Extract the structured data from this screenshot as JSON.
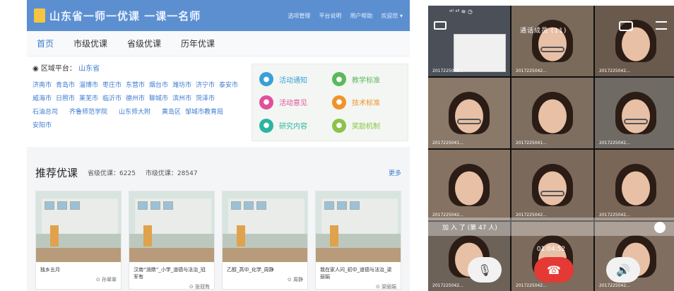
{
  "left": {
    "logo_text": "山东省一师一优课 一课一名师",
    "top_links": [
      "选项管理",
      "平台说明",
      "用户帮助",
      "欢迎您 ▾"
    ],
    "nav": [
      {
        "label": "首页",
        "active": true
      },
      {
        "label": "市级优课",
        "active": false
      },
      {
        "label": "省级优课",
        "active": false
      },
      {
        "label": "历年优课",
        "active": false
      }
    ],
    "region": {
      "title": "区域平台：",
      "province": "山东省"
    },
    "cities": [
      "济南市",
      "青岛市",
      "淄博市",
      "枣庄市",
      "东营市",
      "烟台市",
      "潍坊市",
      "济宁市",
      "泰安市",
      "威海市",
      "日照市",
      "莱芜市",
      "临沂市",
      "德州市",
      "聊城市",
      "滨州市",
      "菏泽市",
      "石油总司",
      "齐鲁师范学院",
      "山东师大附",
      "黄岛区",
      "邹城市教育局",
      "安阳市"
    ],
    "features": [
      {
        "label": "活动通知",
        "icon": "megaphone-icon",
        "color": "#3aa0d8"
      },
      {
        "label": "教学标准",
        "icon": "leaf-icon",
        "color": "#5cb85c"
      },
      {
        "label": "活动意见",
        "icon": "atom-icon",
        "color": "#e0509c"
      },
      {
        "label": "技术标准",
        "icon": "document-icon",
        "color": "#f0932b"
      },
      {
        "label": "研究内容",
        "icon": "book-icon",
        "color": "#2bb5a0"
      },
      {
        "label": "奖励机制",
        "icon": "award-icon",
        "color": "#8bc34a"
      }
    ],
    "recommend": {
      "title": "推荐优课",
      "prov_label": "省级优课：6225",
      "city_label": "市级优课：28547",
      "more": "更多",
      "cards": [
        {
          "title": "独乡五月",
          "author": "⊙ 孙翠翠"
        },
        {
          "title": "汉南“消鼎”_小学_道德与法治_冠军有",
          "author": "⊙ 张冠有"
        },
        {
          "title": "乙醇_高中_化学_周静",
          "author": "⊙ 周静"
        },
        {
          "title": "我在家人问_初中_道德与法治_梁丽娟",
          "author": "⊙ 梁丽娟"
        }
      ]
    }
  },
  "right": {
    "status": "ᵃˡˡ ᵃˡˡ ≋ ◷",
    "caption": "通话成员 (11)",
    "tile_ids": [
      "2017225042...",
      "2017225042...",
      "2017225042...",
      "2017225041...",
      "2017225041...",
      "2017225042...",
      "2017225042...",
      "2017225042...",
      "2017225042...",
      "2017225042...",
      "2017225042...",
      "2017225042..."
    ],
    "overlay_text": "加 入 了 (第 47 人)",
    "timer": "01:04:52",
    "mic_icon": "microphone-icon",
    "hangup_icon": "hangup-icon",
    "speaker_icon": "speaker-icon"
  }
}
